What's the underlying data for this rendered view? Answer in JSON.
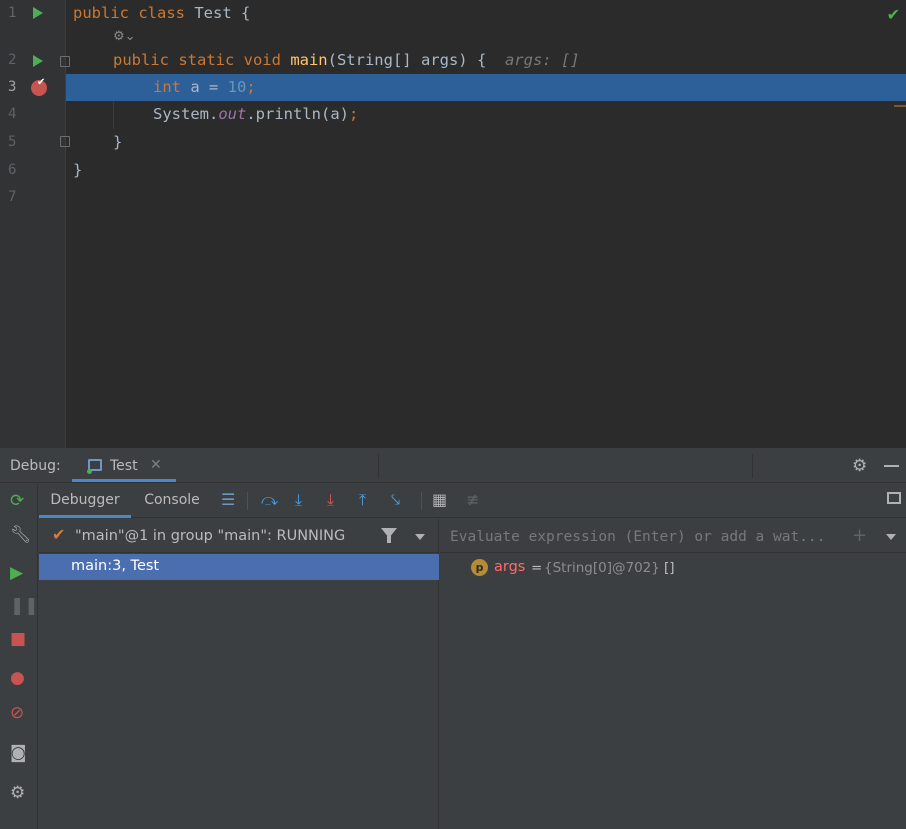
{
  "editor": {
    "line_numbers": [
      "1",
      "2",
      "3",
      "4",
      "5",
      "6",
      "7"
    ],
    "lines": {
      "l1": {
        "kw": "public class ",
        "name": "Test",
        "rest": " {"
      },
      "l2": {
        "kw": "public static void ",
        "fn": "main",
        "rest": "(String[] args) {",
        "hint": "args: []"
      },
      "l3": {
        "kw": "int",
        "mid": " a = ",
        "num": "10",
        "end": ";"
      },
      "l4": {
        "pre": "System.",
        "fld": "out",
        "post": ".println(a)",
        "end": ";"
      },
      "l5": {
        "text": "}"
      },
      "l6": {
        "text": "}"
      }
    },
    "status_icon": "check-icon",
    "accent": "#2d6099"
  },
  "debug": {
    "title": "Debug:",
    "session_tab": "Test",
    "close_glyph": "✕",
    "tabs": {
      "debugger": "Debugger",
      "console": "Console"
    },
    "thread": "\"main\"@1 in group \"main\": RUNNING",
    "frame": "main:3, Test",
    "eval_placeholder": "Evaluate expression (Enter) or add a wat...",
    "var": {
      "badge": "p",
      "name": "args",
      "eq": "=",
      "type": "{String[0]@702}",
      "value": "[]"
    }
  }
}
